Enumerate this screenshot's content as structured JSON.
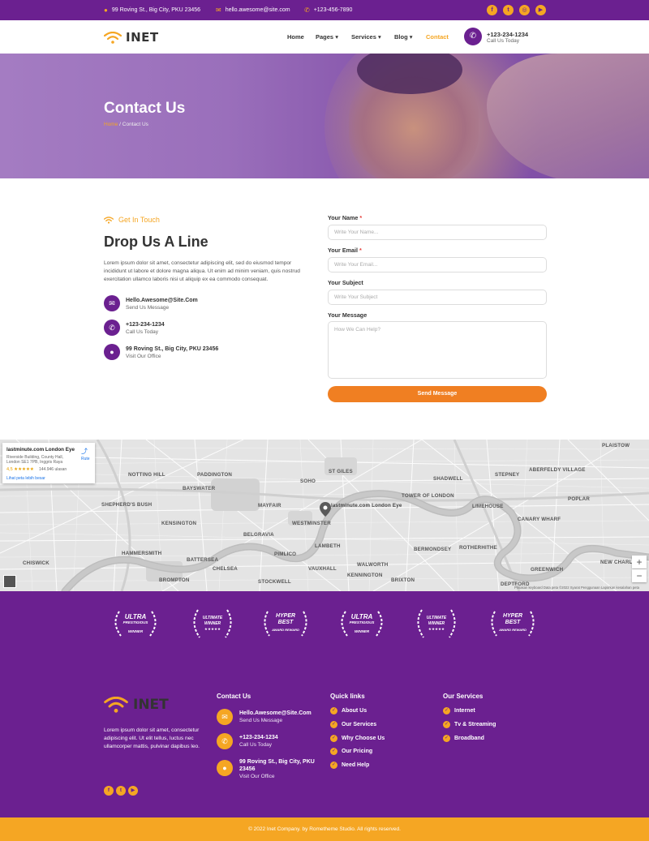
{
  "topbar": {
    "address": "99 Roving St., Big City, PKU 23456",
    "email": "hello.awesome@site.com",
    "phone": "+123-456-7890"
  },
  "header": {
    "logo": "INET",
    "nav": [
      "Home",
      "Pages",
      "Services",
      "Blog",
      "Contact"
    ],
    "phone": "+123-234-1234",
    "phone_sub": "Call Us Today"
  },
  "hero": {
    "title": "Contact Us",
    "crumb_home": "Home",
    "crumb_current": "/ Contact Us"
  },
  "contact": {
    "tag": "Get In Touch",
    "heading": "Drop Us A Line",
    "paragraph": "Lorem ipsum dolor sit amet, consectetur adipiscing elit, sed do eiusmod tempor incididunt ut labore et dolore magna aliqua. Ut enim ad minim veniam, quis nostrud exercitation ullamco laboris nisi ut aliquip ex ea commodo consequat.",
    "info": [
      {
        "title": "Hello.Awesome@Site.Com",
        "sub": "Send Us Message"
      },
      {
        "title": "+123-234-1234",
        "sub": "Call Us Today"
      },
      {
        "title": "99 Roving St., Big City, PKU 23456",
        "sub": "Visit Our Office"
      }
    ]
  },
  "form": {
    "name_label": "Your Name",
    "name_placeholder": "Write Your Name...",
    "email_label": "Your Email",
    "email_placeholder": "Write Your Email...",
    "subject_label": "Your Subject",
    "subject_placeholder": "Write Your Subject",
    "message_label": "Your Message",
    "message_placeholder": "How We Can Help?",
    "required_mark": "*",
    "submit": "Send Message"
  },
  "map": {
    "card_title": "lastminute.com London Eye",
    "card_addr1": "Riverside Building, County Hall,",
    "card_addr2": "London SE1 7PB, Inggris Raya",
    "card_rating": "4,5 ★★★★★",
    "card_reviews": "144.946 ulasan",
    "card_link": "Lihat peta lebih besar",
    "card_route": "Rute",
    "pin_label": "lastminute.com London Eye",
    "labels": [
      "NOTTING HILL",
      "PADDINGTON",
      "MAYFAIR",
      "SHEPHERD'S BUSH",
      "KENSINGTON",
      "HAMMERSMITH",
      "CHELSEA",
      "BRIXTON",
      "LAMBETH",
      "WALWORTH",
      "VAUXHALL",
      "BERMONDSEY",
      "ROTHERHITHE",
      "SHADWELL",
      "LIMEHOUSE",
      "PLAISTOW",
      "CANARY WHARF",
      "GREENWICH",
      "DEPTFORD",
      "NEW CHARLTON",
      "CHISWICK",
      "BAYSWATER",
      "BELGRAVIA",
      "SOHO",
      "ST GILES",
      "STEPNEY",
      "POPLAR",
      "WESTMINSTER",
      "ABERFELDY VILLAGE",
      "BROMPTON",
      "PIMLICO",
      "KENNINGTON",
      "STOCKWELL",
      "BATTERSEA",
      "TOWER OF LONDON"
    ],
    "footer_note": "Pintasan keyboard   Data peta ©2022   Syarat Penggunaan   Laporkan kesalahan peta"
  },
  "awards": [
    {
      "line1": "ULTRA",
      "line2": "PRESTIGIOUS",
      "line3": "WINNER"
    },
    {
      "line1": "ULTIMATE",
      "line2": "WINNER",
      "line3": "★★★★★"
    },
    {
      "line1": "HYPER",
      "line2": "BEST",
      "line3": "AWARD REWARD"
    },
    {
      "line1": "ULTRA",
      "line2": "PRESTIGIOUS",
      "line3": "WINNER"
    },
    {
      "line1": "ULTIMATE",
      "line2": "WINNER",
      "line3": "★★★★★"
    },
    {
      "line1": "HYPER",
      "line2": "BEST",
      "line3": "AWARD REWARD"
    }
  ],
  "footer": {
    "logo": "INET",
    "paragraph": "Lorem ipsum dolor sit amet, consectetur adipiscing elit. Ut elit tellus, luctus nec ullamcorper mattis, pulvinar dapibus leo.",
    "contact_title": "Contact Us",
    "contact": [
      {
        "title": "Hello.Awesome@Site.Com",
        "sub": "Send Us Message"
      },
      {
        "title": "+123-234-1234",
        "sub": "Call Us Today"
      },
      {
        "title": "99 Roving St., Big City, PKU",
        "title2": "23456",
        "sub": "Visit Our Office"
      }
    ],
    "quick_title": "Quick links",
    "quick": [
      "About Us",
      "Our Services",
      "Why Choose Us",
      "Our Pricing",
      "Need Help"
    ],
    "services_title": "Our Services",
    "services": [
      "Internet",
      "Tv & Streaming",
      "Broadband"
    ],
    "copyright": "© 2022 Inet Company. by Rometheme Studio. All rights reserved."
  },
  "colors": {
    "purple": "#6b2090",
    "orange": "#f5a623",
    "button": "#f07f22"
  }
}
